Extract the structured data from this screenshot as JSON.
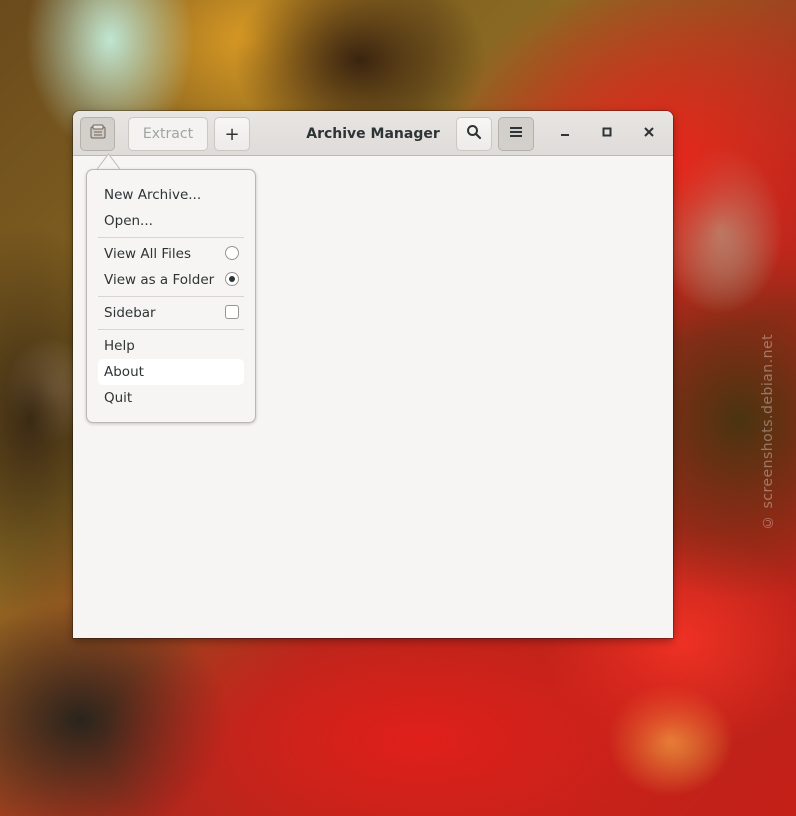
{
  "window": {
    "title": "Archive Manager"
  },
  "toolbar": {
    "extract_label": "Extract",
    "add_label": "+",
    "search_icon": "search-icon",
    "menu_icon": "hamburger-icon",
    "app_icon": "archive-icon"
  },
  "window_controls": {
    "minimize": "–",
    "maximize": "□",
    "close": "✕"
  },
  "menu": {
    "items": [
      {
        "label": "New Archive..."
      },
      {
        "label": "Open..."
      },
      {
        "label": "View All Files",
        "type": "radio",
        "selected": false
      },
      {
        "label": "View as a Folder",
        "type": "radio",
        "selected": true
      },
      {
        "label": "Sidebar",
        "type": "check",
        "checked": false
      },
      {
        "label": "Help"
      },
      {
        "label": "About",
        "hovered": true
      },
      {
        "label": "Quit"
      }
    ]
  },
  "watermark": "© screenshots.debian.net"
}
